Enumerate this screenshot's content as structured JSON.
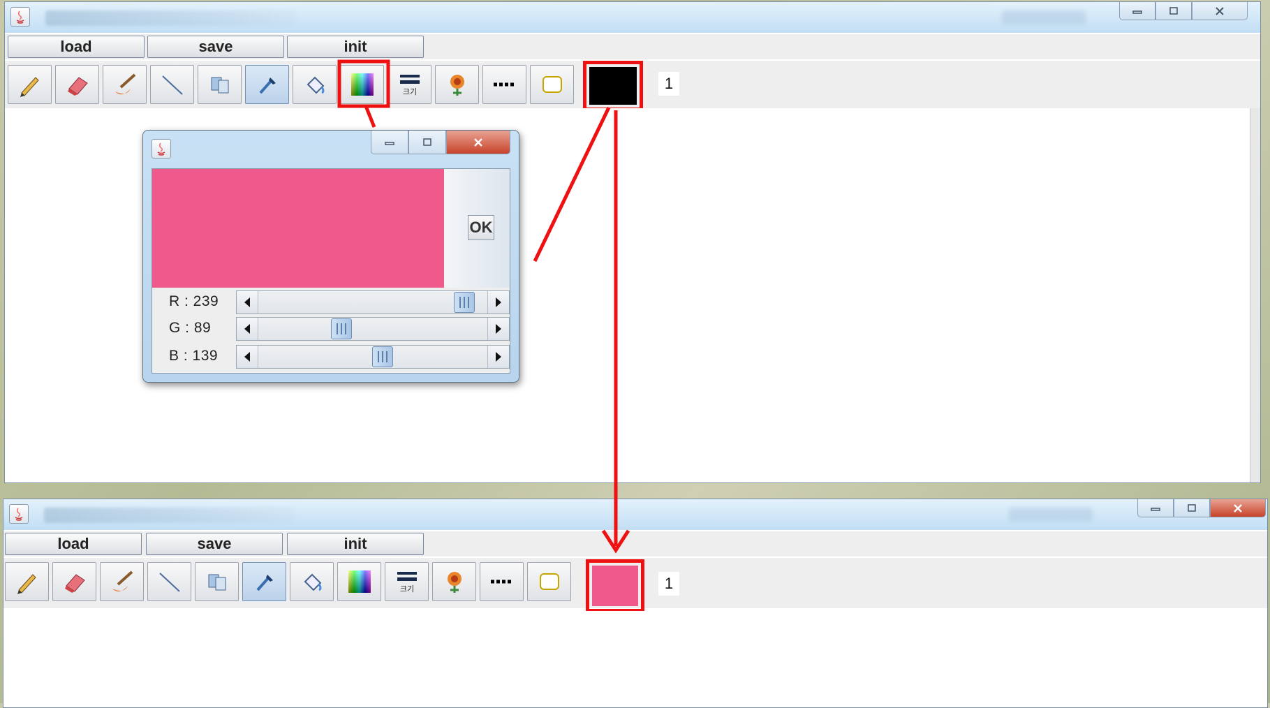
{
  "top_window": {
    "buttons": {
      "load": "load",
      "save": "save",
      "init": "init"
    },
    "thickness_value": "1",
    "current_color": "#000000"
  },
  "bottom_window": {
    "buttons": {
      "load": "load",
      "save": "save",
      "init": "init"
    },
    "thickness_value": "1",
    "current_color": "#ef598b"
  },
  "toolbar": {
    "tools": [
      "pencil-icon",
      "eraser-icon",
      "brush-icon",
      "line-icon",
      "shape-icon",
      "eyedropper-icon",
      "fill-bucket-icon",
      "color-palette-icon",
      "line-thickness-icon",
      "stamp-icon",
      "dashed-line-icon",
      "rounded-rect-icon"
    ],
    "thickness_caption": "크기"
  },
  "color_dialog": {
    "ok_label": "OK",
    "preview_color": "#ef598b",
    "sliders": [
      {
        "label": "R : 239",
        "value": 239,
        "max": 255
      },
      {
        "label": "G : 89",
        "value": 89,
        "max": 255
      },
      {
        "label": "B : 139",
        "value": 139,
        "max": 255
      }
    ]
  },
  "annotation": {
    "color": "#ee1111"
  }
}
